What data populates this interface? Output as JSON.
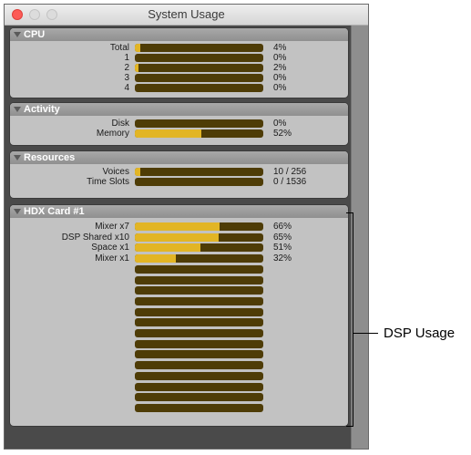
{
  "window": {
    "title": "System Usage"
  },
  "cpu": {
    "title": "CPU",
    "rows": [
      {
        "label": "Total",
        "value": "4%",
        "level": 0.04
      },
      {
        "label": "1",
        "value": "0%",
        "level": 0.0
      },
      {
        "label": "2",
        "value": "2%",
        "level": 0.02
      },
      {
        "label": "3",
        "value": "0%",
        "level": 0.0
      },
      {
        "label": "4",
        "value": "0%",
        "level": 0.0
      }
    ]
  },
  "activity": {
    "title": "Activity",
    "rows": [
      {
        "label": "Disk",
        "value": "0%",
        "level": 0.0
      },
      {
        "label": "Memory",
        "value": "52%",
        "level": 0.52
      }
    ]
  },
  "resources": {
    "title": "Resources",
    "rows": [
      {
        "label": "Voices",
        "value": "10 / 256",
        "level": 0.04
      },
      {
        "label": "Time Slots",
        "value": "0 / 1536",
        "level": 0.0
      }
    ]
  },
  "hdx": {
    "title": "HDX Card #1",
    "rows": [
      {
        "label": "Mixer x7",
        "value": "66%",
        "level": 0.66
      },
      {
        "label": "DSP Shared x10",
        "value": "65%",
        "level": 0.65
      },
      {
        "label": "Space x1",
        "value": "51%",
        "level": 0.51
      },
      {
        "label": "Mixer x1",
        "value": "32%",
        "level": 0.32
      },
      {
        "label": "",
        "value": "",
        "level": 0.0
      },
      {
        "label": "",
        "value": "",
        "level": 0.0
      },
      {
        "label": "",
        "value": "",
        "level": 0.0
      },
      {
        "label": "",
        "value": "",
        "level": 0.0
      },
      {
        "label": "",
        "value": "",
        "level": 0.0
      },
      {
        "label": "",
        "value": "",
        "level": 0.0
      },
      {
        "label": "",
        "value": "",
        "level": 0.0
      },
      {
        "label": "",
        "value": "",
        "level": 0.0
      },
      {
        "label": "",
        "value": "",
        "level": 0.0
      },
      {
        "label": "",
        "value": "",
        "level": 0.0
      },
      {
        "label": "",
        "value": "",
        "level": 0.0
      },
      {
        "label": "",
        "value": "",
        "level": 0.0
      },
      {
        "label": "",
        "value": "",
        "level": 0.0
      },
      {
        "label": "",
        "value": "",
        "level": 0.0
      }
    ]
  },
  "annotation": {
    "text": "DSP Usage"
  },
  "colors": {
    "bar_fill": "#e2b525",
    "bar_track": "#4e3c06",
    "close": "#fc5b57"
  }
}
